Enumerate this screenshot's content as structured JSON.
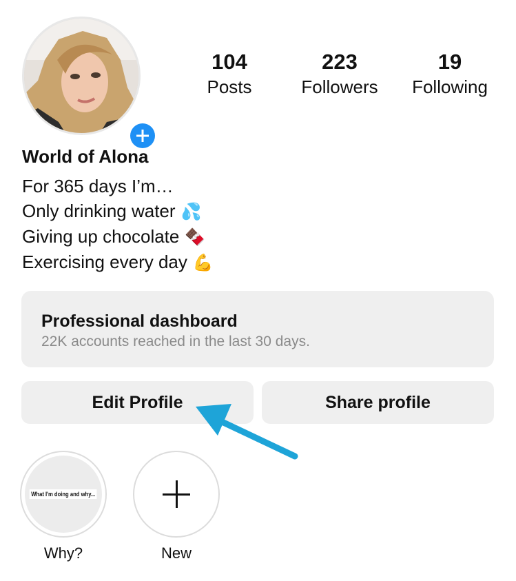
{
  "profile": {
    "display_name": "World of Alona",
    "bio": [
      {
        "text": "For 365 days I’m…",
        "emoji": ""
      },
      {
        "text": "Only drinking water",
        "emoji": "💦"
      },
      {
        "text": "Giving up chocolate",
        "emoji": "🍫"
      },
      {
        "text": "Exercising every day",
        "emoji": "💪"
      }
    ]
  },
  "stats": {
    "posts": {
      "value": "104",
      "label": "Posts"
    },
    "followers": {
      "value": "223",
      "label": "Followers"
    },
    "following": {
      "value": "19",
      "label": "Following"
    }
  },
  "dashboard": {
    "title": "Professional dashboard",
    "subtitle": "22K accounts reached in the last 30 days."
  },
  "buttons": {
    "edit_profile": "Edit Profile",
    "share_profile": "Share profile"
  },
  "highlights": [
    {
      "label": "Why?",
      "cover_text": "What I'm doing and why..."
    },
    {
      "label": "New",
      "icon": "plus-icon"
    }
  ],
  "colors": {
    "accent_blue": "#1e90f5",
    "annotation_arrow": "#1ea4d8",
    "button_bg": "#efefef",
    "secondary_text": "#8a8a8a"
  }
}
